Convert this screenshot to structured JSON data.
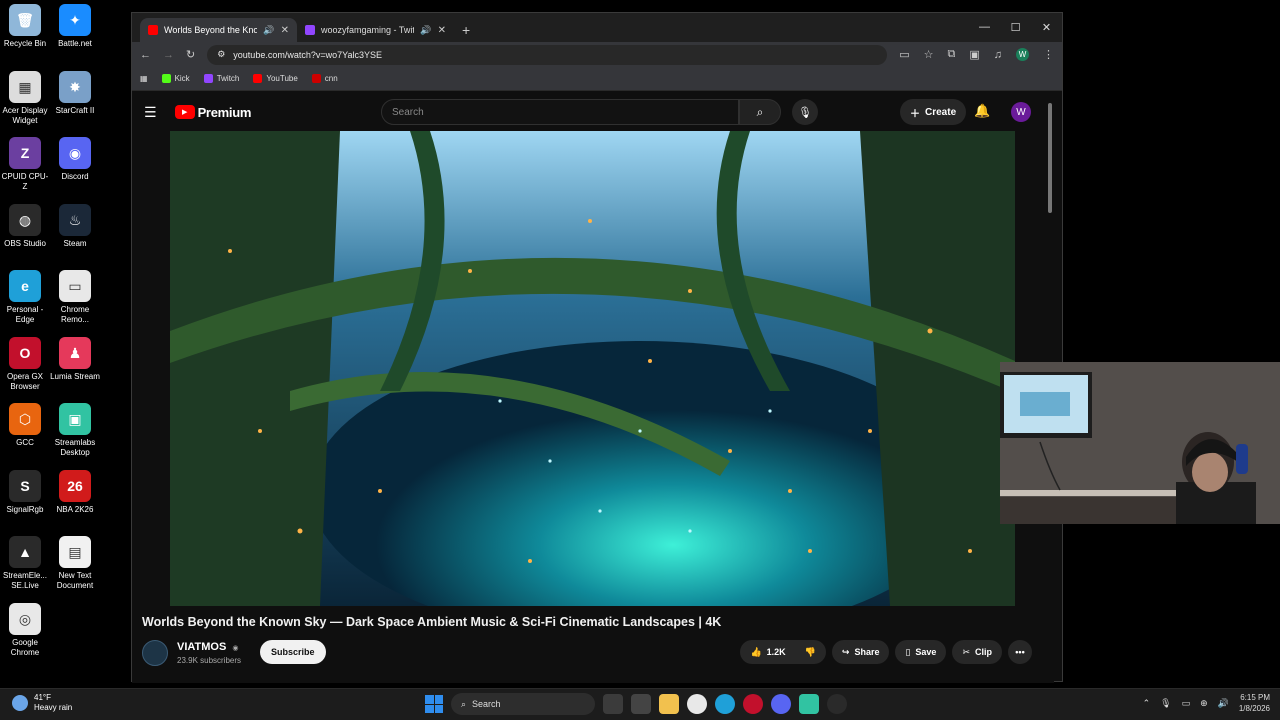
{
  "desktop": {
    "icons": [
      {
        "label": "Recycle Bin",
        "glyph": "🗑",
        "color": "#8fb7d9"
      },
      {
        "label": "Battle.net",
        "glyph": "✦",
        "color": "#1a8cff"
      },
      {
        "label": "Acer Display Widget",
        "glyph": "▦",
        "color": "#dddddd"
      },
      {
        "label": "StarCraft II",
        "glyph": "✸",
        "color": "#7aa0c8"
      },
      {
        "label": "CPUID CPU-Z",
        "glyph": "Z",
        "color": "#6b3fa0"
      },
      {
        "label": "Discord",
        "glyph": "◉",
        "color": "#5865f2"
      },
      {
        "label": "OBS Studio",
        "glyph": "◍",
        "color": "#2a2a2a"
      },
      {
        "label": "Steam",
        "glyph": "♨",
        "color": "#1b2838"
      },
      {
        "label": "Personal - Edge",
        "glyph": "e",
        "color": "#1fa0d8"
      },
      {
        "label": "Chrome Remo...",
        "glyph": "▭",
        "color": "#e8e8e8"
      },
      {
        "label": "Opera GX Browser",
        "glyph": "O",
        "color": "#c2102c"
      },
      {
        "label": "Lumia Stream",
        "glyph": "♟",
        "color": "#e5395b"
      },
      {
        "label": "GCC",
        "glyph": "⬡",
        "color": "#e8650f"
      },
      {
        "label": "Streamlabs Desktop",
        "glyph": "▣",
        "color": "#31c3a2"
      },
      {
        "label": "SignalRgb",
        "glyph": "S",
        "color": "#2a2a2a"
      },
      {
        "label": "NBA 2K26",
        "glyph": "26",
        "color": "#d11b1b"
      },
      {
        "label": "StreamEle... SE.Live",
        "glyph": "▲",
        "color": "#2a2a2a"
      },
      {
        "label": "New Text Document",
        "glyph": "▤",
        "color": "#f1f1f1"
      },
      {
        "label": "Google Chrome",
        "glyph": "◎",
        "color": "#e8e8e8"
      }
    ]
  },
  "browser": {
    "tabs": [
      {
        "title": "Worlds Beyond the Known",
        "favicon_color": "#ff0000",
        "active": true
      },
      {
        "title": "woozyfamgaming - Twitch",
        "favicon_color": "#9146ff",
        "active": false
      }
    ],
    "new_tab": "+",
    "url": "youtube.com/watch?v=wo7Yalc3YSE",
    "profile_letter": "W",
    "bookmarks": [
      {
        "label": "Kick",
        "color": "#53fc18"
      },
      {
        "label": "Twitch",
        "color": "#9146ff"
      },
      {
        "label": "YouTube",
        "color": "#ff0000"
      },
      {
        "label": "cnn",
        "color": "#cc0000"
      }
    ]
  },
  "youtube": {
    "logo_text": "Premium",
    "search_placeholder": "Search",
    "create_label": "Create",
    "avatar_letter": "W",
    "video": {
      "title": "Worlds Beyond the Known Sky — Dark Space Ambient Music & Sci-Fi Cinematic Landscapes | 4K",
      "channel": "VIATMOS",
      "verified": "◉",
      "subscribers": "23.9K subscribers",
      "subscribe_label": "Subscribe",
      "likes": "1.2K",
      "share_label": "Share",
      "save_label": "Save",
      "clip_label": "Clip"
    }
  },
  "taskbar": {
    "weather_temp": "41°F",
    "weather_desc": "Heavy rain",
    "search_label": "Search",
    "time": "6:15 PM",
    "date": "1/8/2026"
  }
}
